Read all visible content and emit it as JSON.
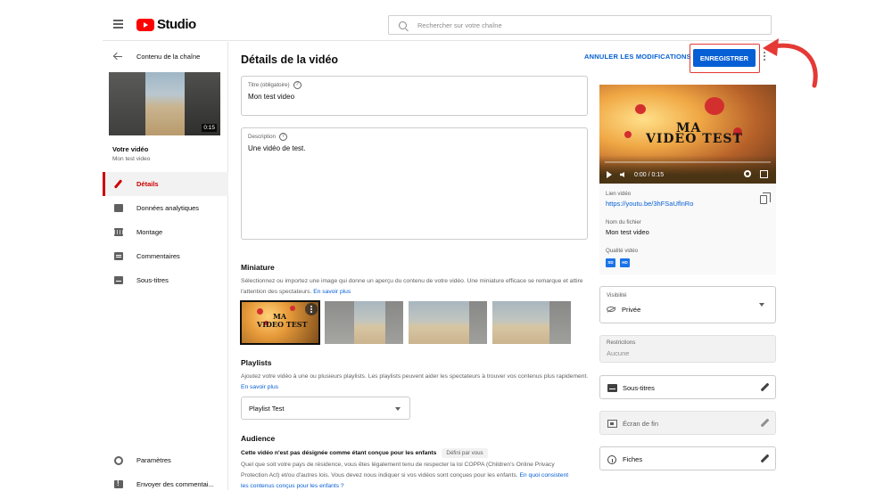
{
  "app": {
    "logo_text": "Studio",
    "search_placeholder": "Rechercher sur votre chaîne"
  },
  "sidebar": {
    "back_label": "Contenu de la chaîne",
    "video_duration": "0:15",
    "your_video_label": "Votre vidéo",
    "video_name": "Mon test video",
    "items": [
      {
        "label": "Détails",
        "icon": "pencil-icon",
        "active": true
      },
      {
        "label": "Données analytiques",
        "icon": "analytics-icon"
      },
      {
        "label": "Montage",
        "icon": "editor-icon"
      },
      {
        "label": "Commentaires",
        "icon": "comments-icon"
      },
      {
        "label": "Sous-titres",
        "icon": "subtitles-icon"
      }
    ],
    "bottom_items": [
      {
        "label": "Paramètres",
        "icon": "gear-icon"
      },
      {
        "label": "Envoyer des commentai...",
        "icon": "feedback-icon"
      }
    ]
  },
  "header": {
    "title": "Détails de la vidéo",
    "undo_label": "ANNULER LES MODIFICATIONS",
    "save_label": "ENREGISTRER"
  },
  "form": {
    "title_label": "Titre (obligatoire)",
    "title_value": "Mon test video",
    "description_label": "Description",
    "description_value": "Une vidéo de test.",
    "thumbnail": {
      "heading": "Miniature",
      "text": "Sélectionnez ou importez une image qui donne un aperçu du contenu de votre vidéo. Une miniature efficace se remarque et attire l'attention des spectateurs.",
      "link": "En savoir plus",
      "selected_title_line1": "MA",
      "selected_title_line2": "VIDEO TEST"
    },
    "playlists": {
      "heading": "Playlists",
      "text": "Ajoutez votre vidéo à une ou plusieurs playlists. Les playlists peuvent aider les spectateurs à trouver vos contenus plus rapidement.",
      "link": "En savoir plus",
      "selected": "Playlist Test"
    },
    "audience": {
      "heading": "Audience",
      "question": "Cette vidéo n'est pas désignée comme étant conçue pour les enfants",
      "chip": "Défini par vous",
      "text": "Quel que soit votre pays de résidence, vous êtes légalement tenu de respecter la loi COPPA (Children's Online Privacy Protection Act) et/ou d'autres lois. Vous devez nous indiquer si vos vidéos sont conçues pour les enfants.",
      "link": "En quoi consistent les contenus conçus pour les enfants ?"
    }
  },
  "preview": {
    "title_line1": "MA",
    "title_line2": "VIDEO TEST",
    "time": "0:00 / 0:15",
    "link_label": "Lien vidéo",
    "link_value": "https://youtu.be/3hFSaUflnRo",
    "filename_label": "Nom du fichier",
    "filename_value": "Mon test video",
    "quality_label": "Qualité vidéo",
    "quality_badges": [
      "SD",
      "HD"
    ]
  },
  "settings": {
    "visibility_label": "Visibilité",
    "visibility_value": "Privée",
    "restrictions_label": "Restrictions",
    "restrictions_value": "Aucune",
    "subtitles_label": "Sous-titres",
    "end_screen_label": "Écran de fin",
    "cards_label": "Fiches"
  },
  "colors": {
    "accent": "#065fd4",
    "brand": "#ff0000",
    "active": "#cc0000",
    "annotation": "#e53935"
  }
}
